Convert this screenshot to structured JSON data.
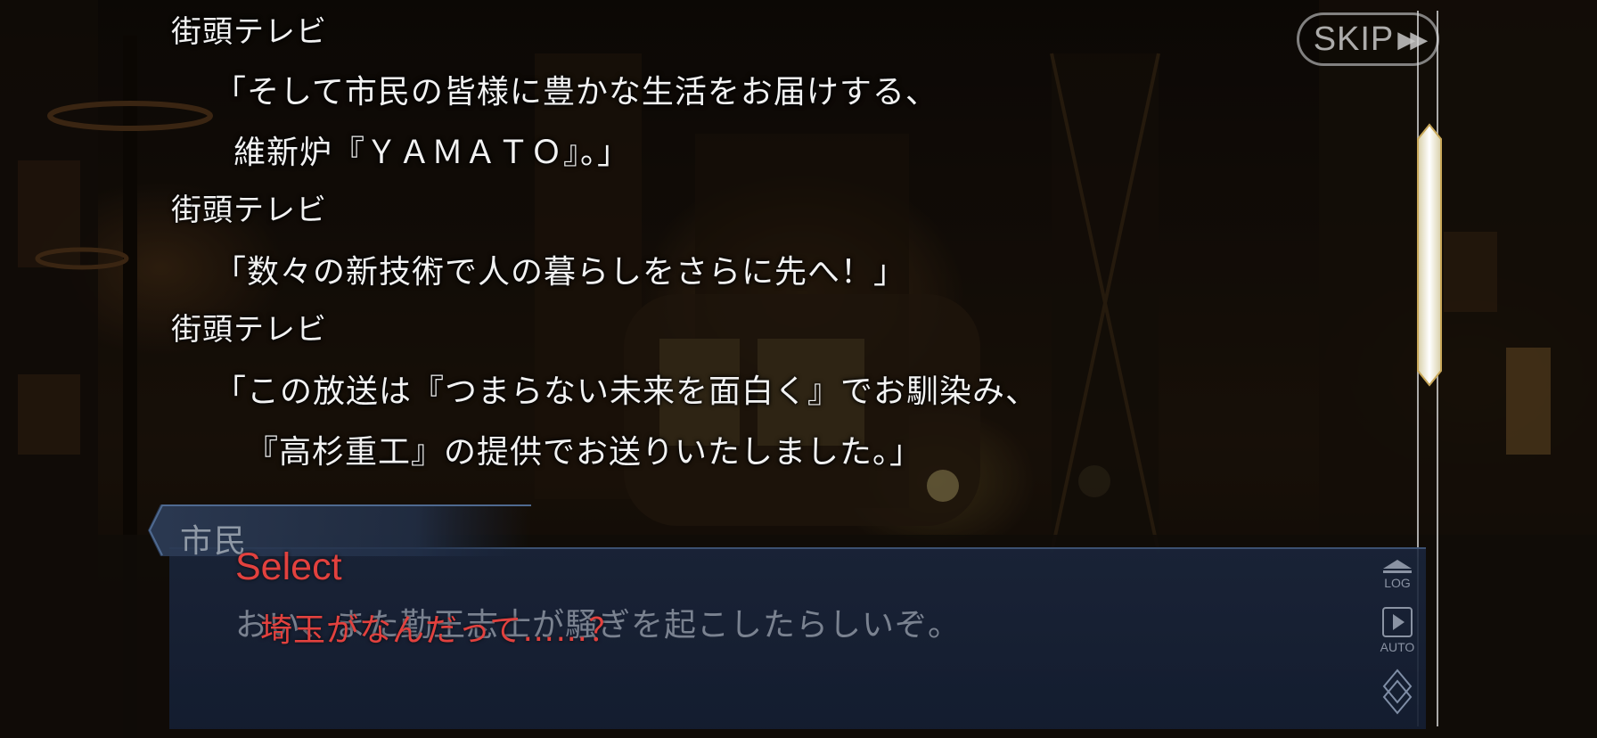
{
  "backlog": [
    {
      "speaker": "街頭テレビ",
      "lines": [
        "「そして市民の皆様に豊かな生活をお届けする、",
        "維新炉『ＹＡＭＡＴＯ』。」"
      ]
    },
    {
      "speaker": "街頭テレビ",
      "lines": [
        "「数々の新技術で人の暮らしをさらに先へ！」"
      ]
    },
    {
      "speaker": "街頭テレビ",
      "lines": [
        "「この放送は『つまらない未来を面白く』でお馴染み、",
        "『高杉重工』の提供でお送りいたしました。」"
      ]
    }
  ],
  "skip_button": {
    "label": "SKIP",
    "icon": "fast-forward-icon"
  },
  "dialogue": {
    "speaker": "市民",
    "text": "おい、また勤王志士が騒ぎを起こしたらしいぞ。"
  },
  "controls": {
    "log_label": "LOG",
    "auto_label": "AUTO",
    "menu_icon": "diamond-menu-icon"
  },
  "select": {
    "title": "Select",
    "choices": [
      "埼玉がなんだって……？"
    ]
  },
  "colors": {
    "select_red": "#e2413e",
    "backlog_text": "#f2f2f2",
    "panel_navy": "#1a263c"
  }
}
